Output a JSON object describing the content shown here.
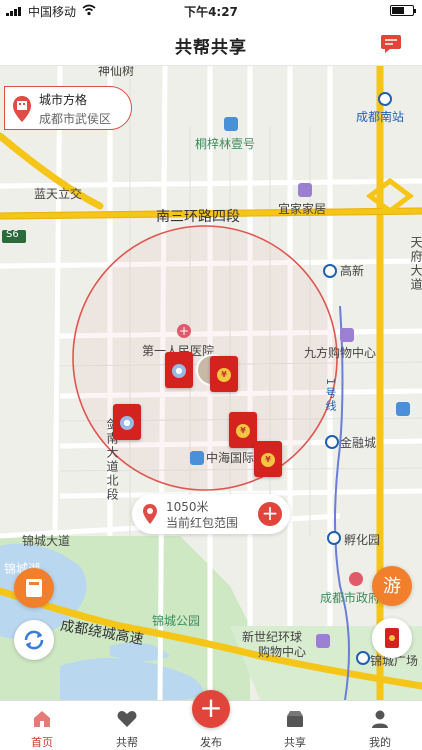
{
  "status_bar": {
    "carrier": "中国移动",
    "time": "下午4:27"
  },
  "nav": {
    "title": "共帮共享"
  },
  "location": {
    "name": "城市方格",
    "address": "成都市武侯区"
  },
  "map_labels": {
    "shenxianshu": "神仙树",
    "chengdu_south": "成都南站",
    "tongzilin": "桐梓林壹号",
    "lantian": "蓝天立交",
    "s6": "S6",
    "yishang": "宜家家居",
    "south_third_ring": "南三环路四段",
    "gaoxin": "高新",
    "tianfu": "天府大道",
    "hospital": "第一人民医院",
    "jiufang": "九方购物中心",
    "line1": "1号线",
    "jian_road": "剑南大道北段",
    "zhonghai": "中海国际中心",
    "jinrongcheng": "金融城",
    "jincheng_ave": "锦城大道",
    "fuhuayuan": "孵化园",
    "jincheng_lake": "锦城湖",
    "chengdu_gov": "成都市政府",
    "jincheng_park": "锦城公园",
    "ring_highway": "成都绕城高速",
    "new_century": "新世纪环球",
    "new_century2": "购物中心",
    "jincheng_square": "锦城广场"
  },
  "range": {
    "distance": "1050米",
    "description": "当前红包范围"
  },
  "tabs": [
    {
      "label": "首页",
      "icon": "home-icon",
      "active": true
    },
    {
      "label": "共帮",
      "icon": "heart-icon",
      "active": false
    },
    {
      "label": "发布",
      "icon": "plus-icon",
      "active": false
    },
    {
      "label": "共享",
      "icon": "box-icon",
      "active": false
    },
    {
      "label": "我的",
      "icon": "user-icon",
      "active": false
    }
  ],
  "colors": {
    "accent": "#e0443a",
    "road_yellow": "#f5c518",
    "circle": "#e05550",
    "water": "#b9d7ee",
    "park": "#cfe8c4"
  }
}
